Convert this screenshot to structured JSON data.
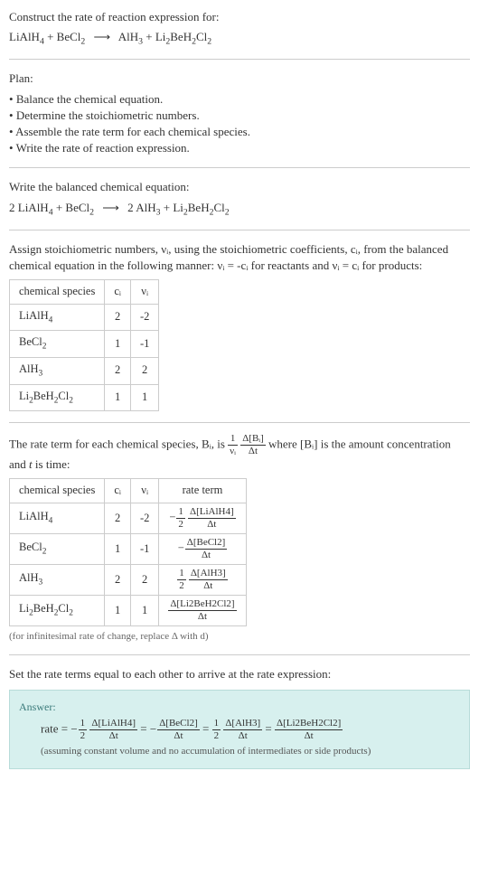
{
  "intro": {
    "prompt": "Construct the rate of reaction expression for:",
    "equation_lhs1": "LiAlH",
    "equation_lhs1_sub": "4",
    "equation_plus1": " + ",
    "equation_lhs2": "BeCl",
    "equation_lhs2_sub": "2",
    "arrow": "⟶",
    "equation_rhs1": "AlH",
    "equation_rhs1_sub": "3",
    "equation_plus2": " + ",
    "equation_rhs2": "Li",
    "equation_rhs2_sub1": "2",
    "equation_rhs2_mid": "BeH",
    "equation_rhs2_sub2": "2",
    "equation_rhs2_end": "Cl",
    "equation_rhs2_sub3": "2"
  },
  "plan": {
    "heading": "Plan:",
    "b1": "Balance the chemical equation.",
    "b2": "Determine the stoichiometric numbers.",
    "b3": "Assemble the rate term for each chemical species.",
    "b4": "Write the rate of reaction expression."
  },
  "balanced": {
    "heading": "Write the balanced chemical equation:",
    "c1": "2 LiAlH",
    "c1sub": "4",
    "plus1": " + ",
    "c2": "BeCl",
    "c2sub": "2",
    "arrow": "⟶",
    "c3": "2 AlH",
    "c3sub": "3",
    "plus2": " + ",
    "c4a": "Li",
    "c4sub1": "2",
    "c4b": "BeH",
    "c4sub2": "2",
    "c4c": "Cl",
    "c4sub3": "2"
  },
  "assign": {
    "text": "Assign stoichiometric numbers, νᵢ, using the stoichiometric coefficients, cᵢ, from the balanced chemical equation in the following manner: νᵢ = -cᵢ for reactants and νᵢ = cᵢ for products:",
    "hdr_species": "chemical species",
    "hdr_c": "cᵢ",
    "hdr_v": "νᵢ",
    "r1_sp": "LiAlH",
    "r1_sub": "4",
    "r1_c": "2",
    "r1_v": "-2",
    "r2_sp": "BeCl",
    "r2_sub": "2",
    "r2_c": "1",
    "r2_v": "-1",
    "r3_sp": "AlH",
    "r3_sub": "3",
    "r3_c": "2",
    "r3_v": "2",
    "r4_a": "Li",
    "r4_s1": "2",
    "r4_b": "BeH",
    "r4_s2": "2",
    "r4_c": "Cl",
    "r4_s3": "2",
    "r4_ci": "1",
    "r4_vi": "1"
  },
  "rate_intro": {
    "p1": "The rate term for each chemical species, Bᵢ, is ",
    "frac1_num": "1",
    "frac1_den": "νᵢ",
    "frac2_num": "Δ[Bᵢ]",
    "frac2_den": "Δt",
    "p2": " where [Bᵢ] is the amount concentration and ",
    "tvar": "t",
    "p3": " is time:"
  },
  "table2": {
    "hdr_species": "chemical species",
    "hdr_c": "cᵢ",
    "hdr_v": "νᵢ",
    "hdr_rate": "rate term"
  },
  "rates": {
    "r1_c": "2",
    "r1_v": "-2",
    "r2_c": "1",
    "r2_v": "-1",
    "r3_c": "2",
    "r3_v": "2",
    "r4_c": "1",
    "r4_v": "1",
    "half_num": "1",
    "half_den": "2",
    "neg": "−",
    "d_lialh4_num": "Δ[LiAlH4]",
    "dt": "Δt",
    "d_becl2_num": "Δ[BeCl2]",
    "d_alh3_num": "Δ[AlH3]",
    "d_li2_num": "Δ[Li2BeH2Cl2]"
  },
  "note": "(for infinitesimal rate of change, replace Δ with d)",
  "set_text": "Set the rate terms equal to each other to arrive at the rate expression:",
  "answer": {
    "label": "Answer:",
    "rate_eq": "rate = ",
    "eq": " = ",
    "assume": "(assuming constant volume and no accumulation of intermediates or side products)"
  }
}
